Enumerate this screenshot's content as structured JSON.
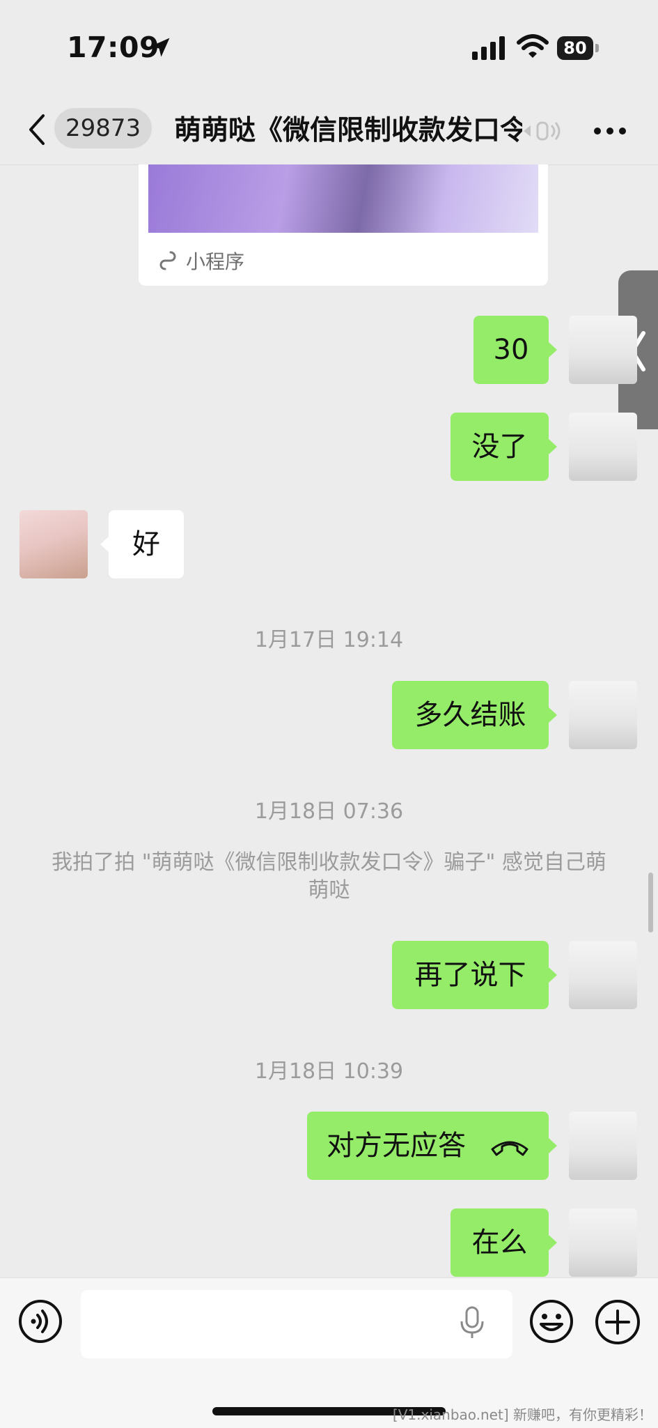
{
  "status_bar": {
    "time": "17:09",
    "battery": "80",
    "icons": [
      "location-arrow-icon",
      "cellular-signal-icon",
      "wifi-icon",
      "battery-icon"
    ]
  },
  "nav": {
    "back_icon": "chevron-left-icon",
    "unread_count": "29873",
    "title": "萌萌哒《微信限制收款发口令》骗子",
    "mute_icon": "muted-speaker-icon",
    "more_icon": "more-dots-icon"
  },
  "mini_program_card": {
    "label": "小程序"
  },
  "messages": [
    {
      "sender": "me",
      "text": "30"
    },
    {
      "sender": "me",
      "text": "没了"
    },
    {
      "sender": "her",
      "text": "好"
    },
    {
      "timestamp": "1月17日 19:14"
    },
    {
      "sender": "me",
      "text": "多久结账"
    },
    {
      "timestamp": "1月18日 07:36"
    },
    {
      "system": "我拍了拍 \"萌萌哒《微信限制收款发口令》骗子\" 感觉自己萌萌哒"
    },
    {
      "sender": "me",
      "text": "再了说下"
    },
    {
      "timestamp": "1月18日 10:39"
    },
    {
      "sender": "me",
      "text": "对方无应答",
      "icon": "hangup-phone-icon"
    },
    {
      "sender": "me",
      "text": "在么"
    }
  ],
  "input_bar": {
    "voice_icon": "voice-input-icon",
    "mic_icon": "microphone-icon",
    "emoji_icon": "emoji-icon",
    "plus_icon": "plus-circle-icon",
    "value": ""
  },
  "watermark": "[V1.xianbao.net] 新赚吧，有你更精彩！",
  "colors": {
    "background": "#ececec",
    "my_bubble": "#95ec69",
    "other_bubble": "#ffffff",
    "timestamp_text": "#9b9b9b"
  }
}
